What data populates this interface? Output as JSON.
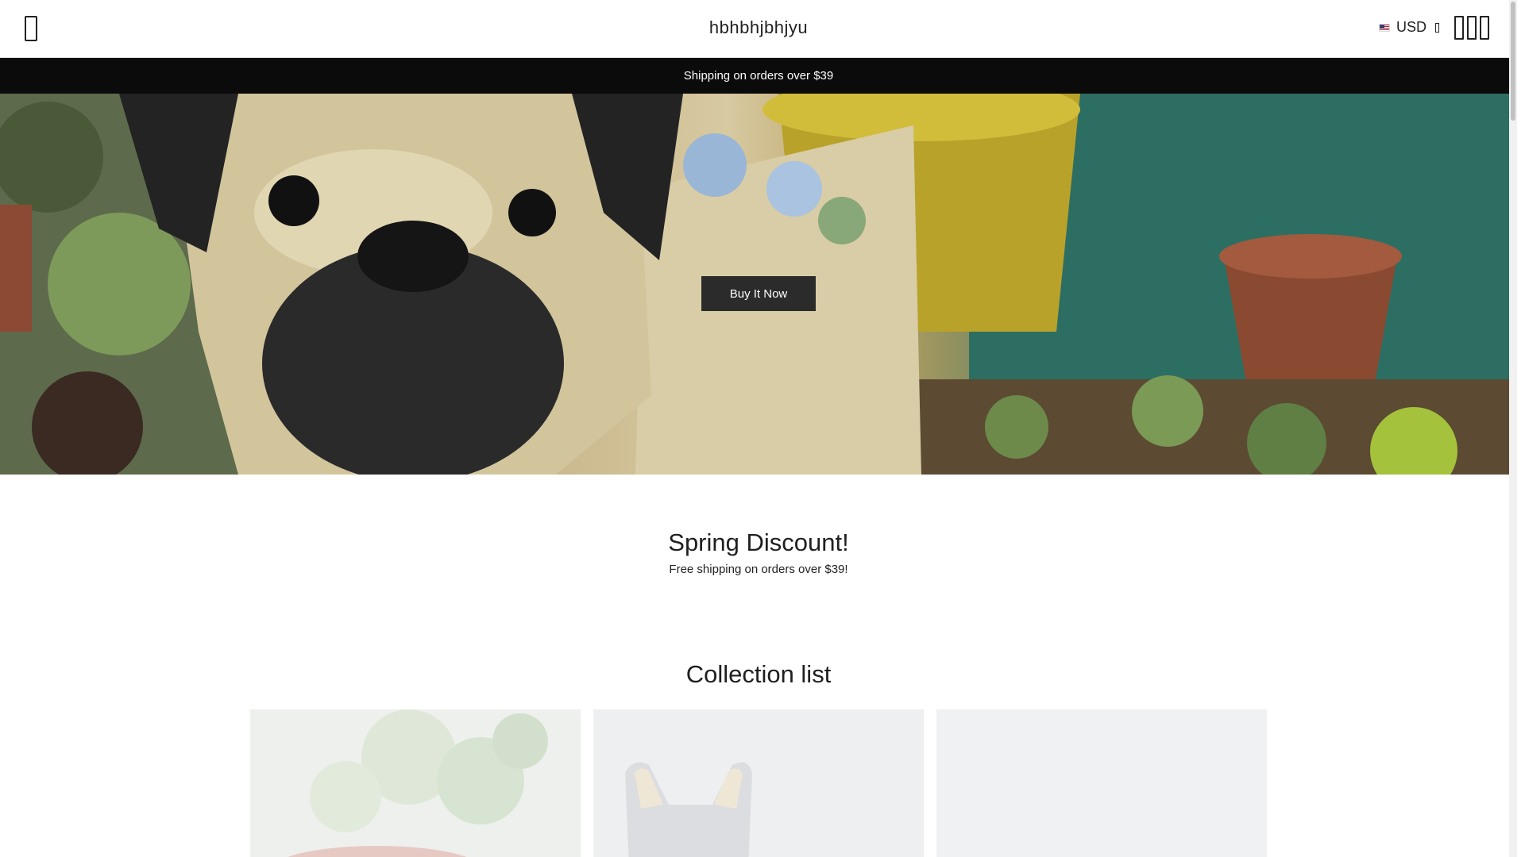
{
  "header": {
    "store_name": "hbhbhjbhjyu",
    "currency": "USD"
  },
  "announcement": {
    "text": "Shipping on orders over $39"
  },
  "hero": {
    "button_label": "Buy It Now"
  },
  "discount": {
    "title": "Spring Discount!",
    "subtitle": "Free shipping on orders over $39!"
  },
  "collection_list": {
    "title": "Collection list",
    "cards": [
      {
        "image": "succulent-plant"
      },
      {
        "image": "dog-planter"
      },
      {
        "image": "placeholder"
      }
    ]
  },
  "icons": {
    "menu": "menu-icon",
    "flag": "us-flag-icon",
    "caret": "caret-icon",
    "search": "search-icon",
    "account": "account-icon",
    "cart": "cart-icon"
  },
  "colors": {
    "announcement_bg": "#0b0b0b",
    "button_bg": "#2b2b2b",
    "card_bg": "#f0f1f2"
  }
}
